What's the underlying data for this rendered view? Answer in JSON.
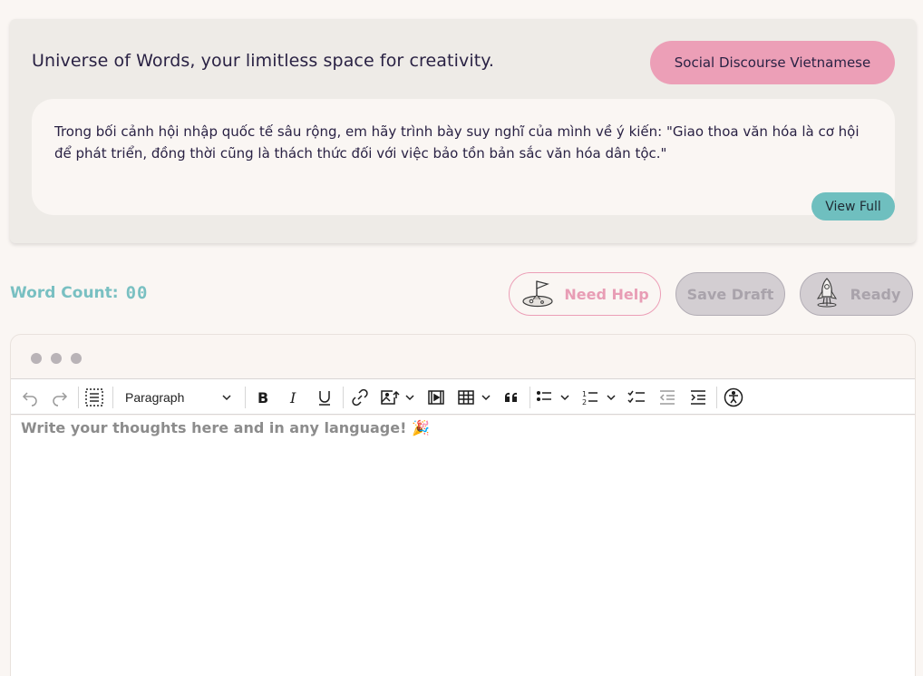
{
  "prompt": {
    "title": "Universe of Words, your limitless space for creativity.",
    "topic": "Social Discourse Vietnamese",
    "question": "Trong bối cảnh hội nhập quốc tế sâu rộng, em hãy trình bày suy nghĩ của mình về ý kiến: \"Giao thoa văn hóa là cơ hội để phát triển, đồng thời cũng là thách thức đối với việc bảo tồn bản sắc văn hóa dân tộc.\"",
    "view_full_label": "View Full"
  },
  "status": {
    "word_count_label": "Word Count:",
    "word_count_value": "00"
  },
  "actions": {
    "need_help_label": "Need Help",
    "save_draft_label": "Save Draft",
    "ready_label": "Ready"
  },
  "editor": {
    "block_format": "Paragraph",
    "placeholder": "Write your thoughts here and in any language! 🎉"
  },
  "colors": {
    "accent_pink": "#ec9fb7",
    "accent_teal": "#6fbfbf",
    "disabled_grey": "#d3ced2"
  }
}
